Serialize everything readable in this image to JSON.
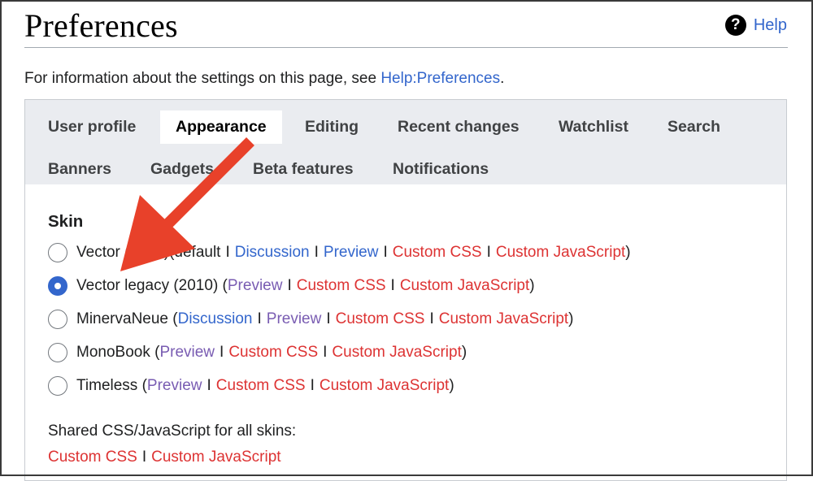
{
  "header": {
    "title": "Preferences",
    "help_label": "Help",
    "help_icon": "question-circle-icon"
  },
  "intro": {
    "text": "For information about the settings on this page, see ",
    "link": "Help:Preferences",
    "suffix": "."
  },
  "tabs": {
    "row1": [
      {
        "label": "User profile",
        "active": false
      },
      {
        "label": "Appearance",
        "active": true
      },
      {
        "label": "Editing",
        "active": false
      },
      {
        "label": "Recent changes",
        "active": false
      },
      {
        "label": "Watchlist",
        "active": false
      },
      {
        "label": "Search",
        "active": false
      }
    ],
    "row2": [
      {
        "label": "Banners",
        "active": false
      },
      {
        "label": "Gadgets",
        "active": false
      },
      {
        "label": "Beta features",
        "active": false
      },
      {
        "label": "Notifications",
        "active": false
      }
    ]
  },
  "skin": {
    "section_title": "Skin",
    "options": [
      {
        "name": "Vector (2022)",
        "selected": false,
        "suffix_text": " (default",
        "links": [
          "Discussion",
          "Preview",
          "Custom CSS",
          "Custom JavaScript"
        ]
      },
      {
        "name": "Vector legacy (2010)",
        "selected": true,
        "links": [
          "Preview",
          "Custom CSS",
          "Custom JavaScript"
        ]
      },
      {
        "name": "MinervaNeue",
        "selected": false,
        "links": [
          "Discussion",
          "Preview",
          "Custom CSS",
          "Custom JavaScript"
        ]
      },
      {
        "name": "MonoBook",
        "selected": false,
        "links": [
          "Preview",
          "Custom CSS",
          "Custom JavaScript"
        ]
      },
      {
        "name": "Timeless",
        "selected": false,
        "links": [
          "Preview",
          "Custom CSS",
          "Custom JavaScript"
        ]
      }
    ],
    "separator": "I",
    "open_paren": "(",
    "close_paren": ")"
  },
  "shared": {
    "label": "Shared CSS/JavaScript for all skins:",
    "links": [
      "Custom CSS",
      "Custom JavaScript"
    ]
  },
  "annotation": {
    "arrow_color": "#e8412a",
    "arrow_target": "Vector legacy (2010)"
  },
  "colors": {
    "link_blue": "#3366cc",
    "link_visited": "#795cb2",
    "link_red": "#dd3333",
    "tabbar_bg": "#eaecf0"
  }
}
